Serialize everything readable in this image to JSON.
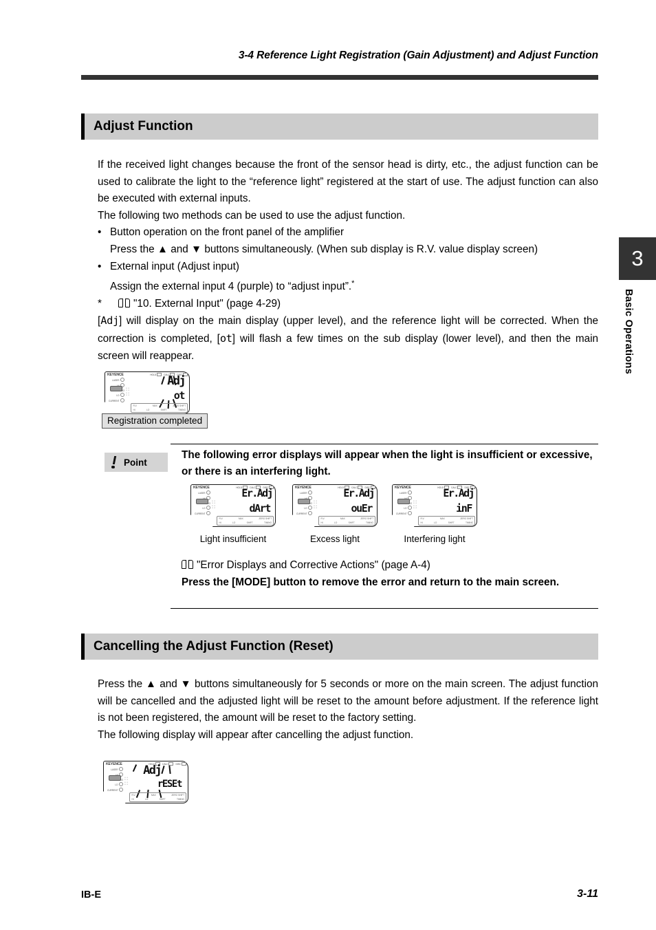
{
  "running_head": "3-4  Reference Light Registration (Gain Adjustment) and Adjust Function",
  "chapter_tab": {
    "number": "3",
    "label": "Basic Operations"
  },
  "sections": {
    "adjust": {
      "heading": "Adjust Function",
      "paragraph1": "If the received light changes because the front of the sensor head is dirty, etc., the adjust function can be used to calibrate the light to the “reference light” registered at the start of use. The adjust function can also be executed with external inputs.",
      "paragraph2": "The following two methods can be used to use the adjust function.",
      "bullet1_title": "Button operation on the front panel of the amplifier",
      "bullet1_body": "Press the ▲ and ▼ buttons simultaneously. (When sub display is R.V. value display screen)",
      "bullet2_title": "External input (Adjust input)",
      "bullet2_body": "Assign the external input 4 (purple) to “adjust input”.",
      "footnote_marker": "*",
      "footnote_text": "\"10. External Input\" (page 4-29)",
      "paragraph3_a": "[",
      "paragraph3_seg1": "Adj",
      "paragraph3_b": "] will display on the main display (upper level), and the reference light will be corrected. When the correction is completed, [",
      "paragraph3_seg2": "ot",
      "paragraph3_c": "] will flash a few times on the sub display (lower level), and then the main screen will reappear.",
      "bullet_char": "•"
    },
    "cancel": {
      "heading": "Cancelling the Adjust Function (Reset)",
      "paragraph1": "Press the ▲ and ▼ buttons simultaneously for 5 seconds or more on the main screen. The adjust function will be cancelled and the adjusted light will be reset to the amount before adjustment. If the reference light is not been registered, the amount will be reset to the factory setting.",
      "paragraph2": "The following display will appear after cancelling the adjust function."
    }
  },
  "point_block": {
    "badge_label": "Point",
    "text": "The following error displays will appear when the light is insufficient or excessive, or there is an interfering light.",
    "reference_text": "\"Error Displays and Corrective Actions\" (page A-4)",
    "instruction": "Press the [MODE] button to remove the error and return to the main screen."
  },
  "amplifier_panel": {
    "brand": "KEYENCE",
    "top_indicators": [
      "HOLD",
      "CALC",
      "DISC"
    ],
    "left_indicators": [
      "LASER",
      "HI",
      "GO",
      "LO",
      "BANK",
      "CURRENT"
    ],
    "bottom_row_1": [
      "R.V.",
      "MAX",
      "ZERO SHIFT"
    ],
    "bottom_row_2": [
      "HI",
      "LO",
      "SHIFT",
      "TIMING"
    ]
  },
  "displays": {
    "completed": {
      "main": "Adj",
      "sub": "ot",
      "callout": "Registration completed"
    },
    "errors": [
      {
        "main": "Er.Adj",
        "sub": "dArt",
        "caption": "Light insufficient"
      },
      {
        "main": "Er.Adj",
        "sub": "ouEr",
        "caption": "Excess light"
      },
      {
        "main": "Er.Adj",
        "sub": "inF",
        "caption": "Interfering light"
      }
    ],
    "reset": {
      "main": "Adj",
      "sub": "rESEt"
    }
  },
  "footer": {
    "left": "IB-E",
    "right": "3-11"
  },
  "colors": {
    "rule": "#333333",
    "section_bg": "#cccccc",
    "tab_bg": "#333333",
    "badge_bg": "#d4d4d4",
    "callout_bg": "#e0e0e0"
  }
}
